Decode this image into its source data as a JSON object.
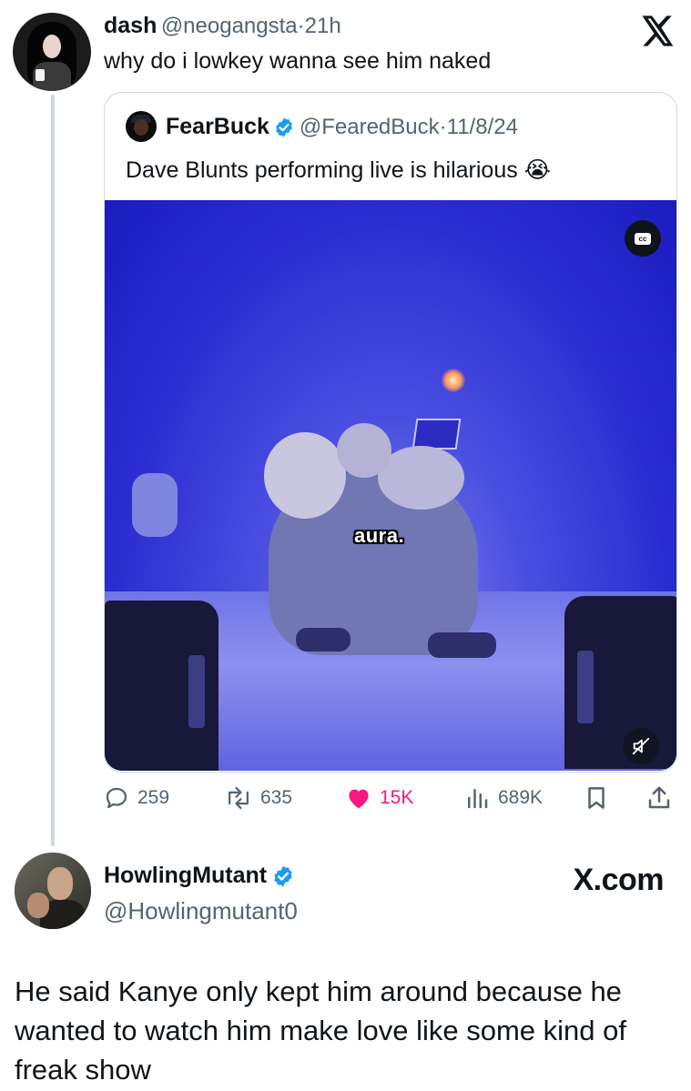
{
  "tweet": {
    "author_name": "dash",
    "author_handle": "@neogangsta",
    "separator": "·",
    "time": "21h",
    "text": "why do i lowkey wanna see him naked"
  },
  "quoted": {
    "author_name": "FearBuck",
    "author_handle": "@FearedBuck",
    "separator": "·",
    "date": "11/8/24",
    "text": "Dave Blunts performing live is hilarious",
    "emoji": "😭",
    "video": {
      "caption": "aura.",
      "cc_label": "cc"
    }
  },
  "actions": {
    "replies": "259",
    "reposts": "635",
    "likes": "15K",
    "views": "689K"
  },
  "colors": {
    "like": "#f91880",
    "verified": "#1d9bf0",
    "muted_text": "#536471"
  },
  "reply": {
    "author_name": "HowlingMutant",
    "author_handle": "@Howlingmutant0",
    "brand": "X.com",
    "text": "He said Kanye only kept him around because he wanted to watch him make love like some kind of freak show"
  }
}
